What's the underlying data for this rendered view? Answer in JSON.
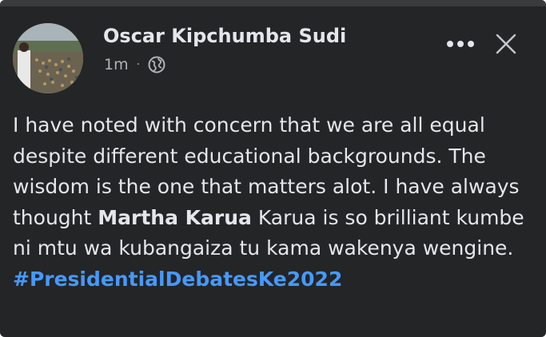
{
  "post": {
    "author": "Oscar Kipchumba Sudi",
    "timestamp": "1m",
    "separator": "·",
    "privacy_icon": "globe-icon",
    "more_icon": "more-options-icon",
    "close_icon": "close-icon",
    "text": {
      "part1": "I have noted with concern that we are all equal despite different educational backgrounds. The wisdom is the one that matters alot. I have always thought ",
      "mention": "Martha Karua",
      "part2": " Karua is so brilliant kumbe ni mtu wa kubangaiza tu kama wakenya wengine.",
      "hashtag": "#PresidentialDebatesKe2022"
    }
  },
  "colors": {
    "background": "#242526",
    "primary_text": "#e4e6eb",
    "secondary_text": "#b0b3b8",
    "hashtag": "#4599ff"
  }
}
